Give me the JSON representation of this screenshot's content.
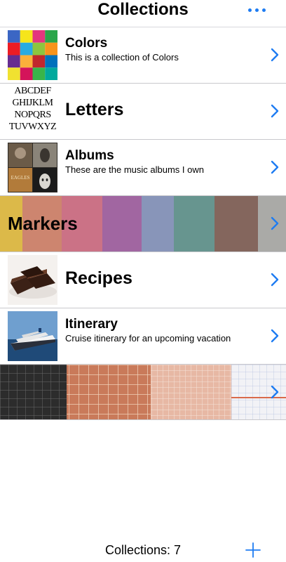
{
  "nav": {
    "title": "Collections",
    "more_icon": "ellipsis-icon"
  },
  "collections": [
    {
      "title": "Colors",
      "subtitle": "This is a collection of Colors",
      "thumbnail": "color-grid"
    },
    {
      "title": "Letters",
      "subtitle": "",
      "thumbnail": "alphabet-letters",
      "thumb_lines": [
        "ABCDEF",
        "GHIJKLM",
        "NOPQRS",
        "TUVWXYZ"
      ]
    },
    {
      "title": "Albums",
      "subtitle": "These are the music albums I own",
      "thumbnail": "album-covers",
      "album_label": "EAGLES"
    },
    {
      "title": "Markers",
      "subtitle": "",
      "thumbnail": "marker-swatches-banner"
    },
    {
      "title": "Recipes",
      "subtitle": "",
      "thumbnail": "brownies-photo"
    },
    {
      "title": "Itinerary",
      "subtitle": "Cruise itinerary for an upcoming vacation",
      "thumbnail": "cruise-ship-photo"
    },
    {
      "title": "",
      "subtitle": "",
      "thumbnail": "graph-paper-banner"
    }
  ],
  "footer": {
    "count_label": "Collections: 7",
    "add_icon": "plus-icon"
  },
  "colors": {
    "accent": "#1e7cf2",
    "separator": "#c8c8cc"
  }
}
